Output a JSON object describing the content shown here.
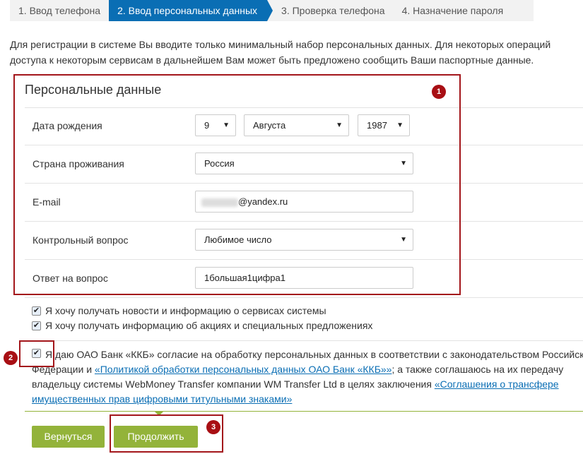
{
  "steps": [
    "1. Ввод телефона",
    "2. Ввод персональных данных",
    "3. Проверка телефона",
    "4. Назначение пароля"
  ],
  "intro": [
    "Для регистрации в системе Вы вводите только минимальный набор персональных данных. Для некоторых операций",
    "доступа к некоторым сервисам в дальнейшем Вам может быть предложено сообщить Ваши паспортные данные."
  ],
  "panel": {
    "title": "Персональные данные",
    "birth_label": "Дата рождения",
    "day": "9",
    "month": "Августа",
    "year": "1987",
    "country_label": "Страна проживания",
    "country": "Россия",
    "email_label": "E-mail",
    "email_domain": "@yandex.ru",
    "question_label": "Контрольный вопрос",
    "question": "Любимое число",
    "answer_label": "Ответ на вопрос",
    "answer": "1большая1цифра1"
  },
  "checks": {
    "news": "Я хочу получать новости и информацию о сервисах системы",
    "promo": "Я хочу получать информацию об акциях и специальных предложениях"
  },
  "consent": {
    "line1": "Я даю ОАО Банк «ККБ» согласие на обработку персональных данных в соответствии с законодательством Российской",
    "line2a": "Федерации и ",
    "link1": "«Политикой обработки персональных данных ОАО Банк «ККБ»»",
    "line2b": "; а также соглашаюсь на их передачу",
    "line3a": "владельцу системы WebMoney Transfer компании WM Transfer Ltd в целях заключения ",
    "link2a": "«Соглашения о трансфере",
    "link2b": "имущественных прав цифровыми титульными знаками»"
  },
  "buttons": {
    "back": "Вернуться",
    "continue": "Продолжить"
  },
  "badges": [
    "1",
    "2",
    "3"
  ]
}
